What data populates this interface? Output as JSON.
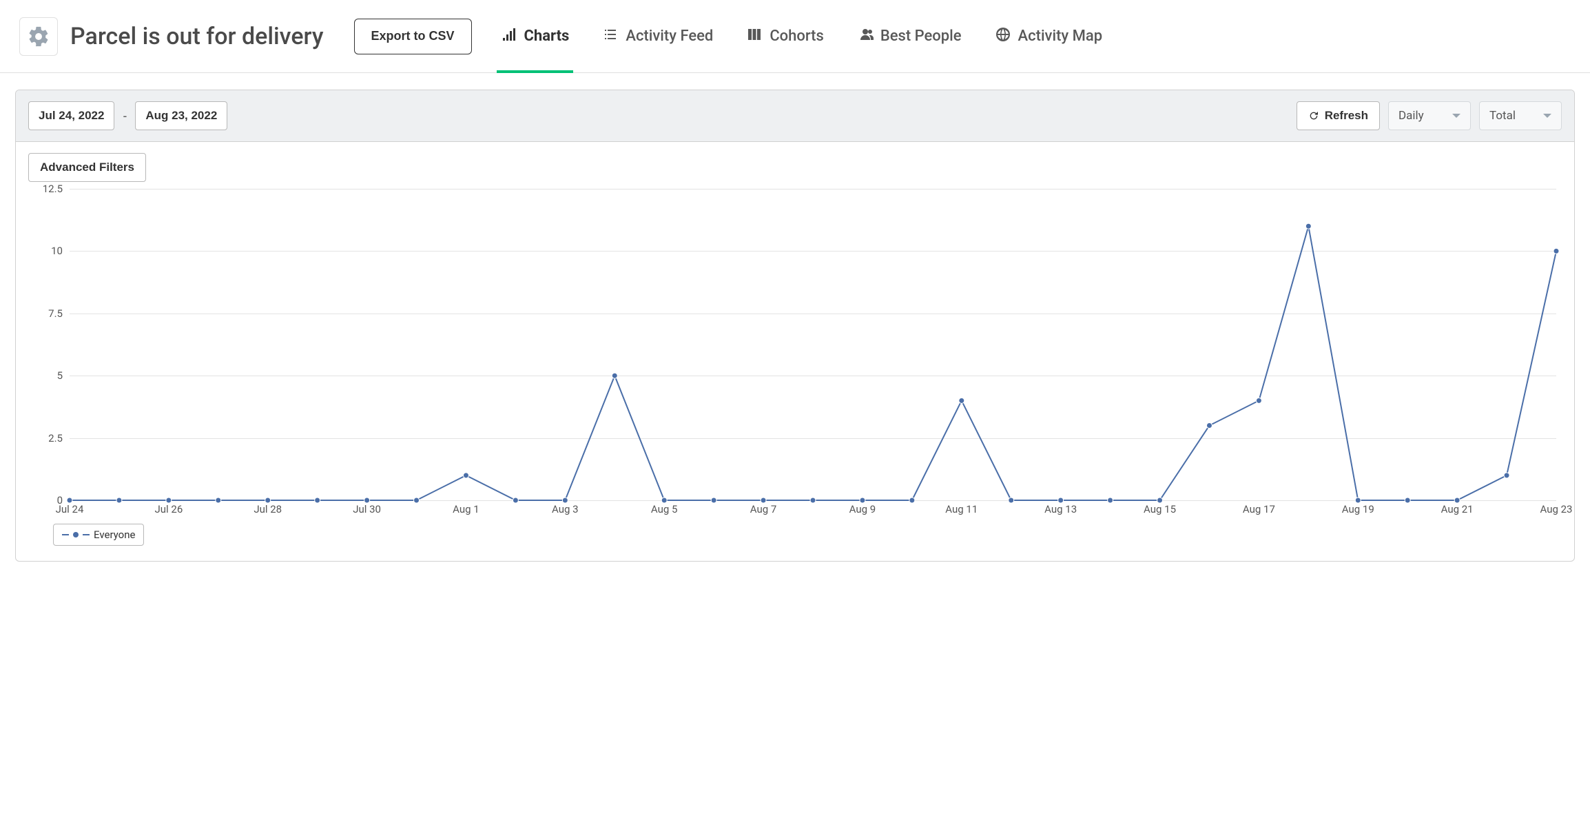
{
  "header": {
    "title": "Parcel is out for delivery",
    "export_label": "Export to CSV",
    "tabs": [
      {
        "label": "Charts",
        "icon": "bar-chart-icon",
        "active": true
      },
      {
        "label": "Activity Feed",
        "icon": "list-icon",
        "active": false
      },
      {
        "label": "Cohorts",
        "icon": "columns-icon",
        "active": false
      },
      {
        "label": "Best People",
        "icon": "people-icon",
        "active": false
      },
      {
        "label": "Activity Map",
        "icon": "globe-icon",
        "active": false
      }
    ]
  },
  "controls": {
    "date_from": "Jul 24, 2022",
    "date_to": "Aug 23, 2022",
    "date_sep": "-",
    "refresh_label": "Refresh",
    "granularity_selected": "Daily",
    "aggregation_selected": "Total",
    "advanced_filters_label": "Advanced Filters"
  },
  "legend": {
    "series_label": "Everyone"
  },
  "chart_data": {
    "type": "line",
    "title": "",
    "xlabel": "",
    "ylabel": "",
    "ylim": [
      0,
      12.5
    ],
    "y_ticks": [
      0,
      2.5,
      5,
      7.5,
      10,
      12.5
    ],
    "x_tick_every": 2,
    "categories": [
      "Jul 24",
      "Jul 25",
      "Jul 26",
      "Jul 27",
      "Jul 28",
      "Jul 29",
      "Jul 30",
      "Jul 31",
      "Aug 1",
      "Aug 2",
      "Aug 3",
      "Aug 4",
      "Aug 5",
      "Aug 6",
      "Aug 7",
      "Aug 8",
      "Aug 9",
      "Aug 10",
      "Aug 11",
      "Aug 12",
      "Aug 13",
      "Aug 14",
      "Aug 15",
      "Aug 16",
      "Aug 17",
      "Aug 18",
      "Aug 19",
      "Aug 20",
      "Aug 21",
      "Aug 22",
      "Aug 23"
    ],
    "series": [
      {
        "name": "Everyone",
        "color": "#4a6ea8",
        "values": [
          0,
          0,
          0,
          0,
          0,
          0,
          0,
          0,
          1,
          0,
          0,
          5,
          0,
          0,
          0,
          0,
          0,
          0,
          4,
          0,
          0,
          0,
          0,
          3,
          4,
          11,
          0,
          0,
          0,
          1,
          10
        ]
      }
    ]
  }
}
